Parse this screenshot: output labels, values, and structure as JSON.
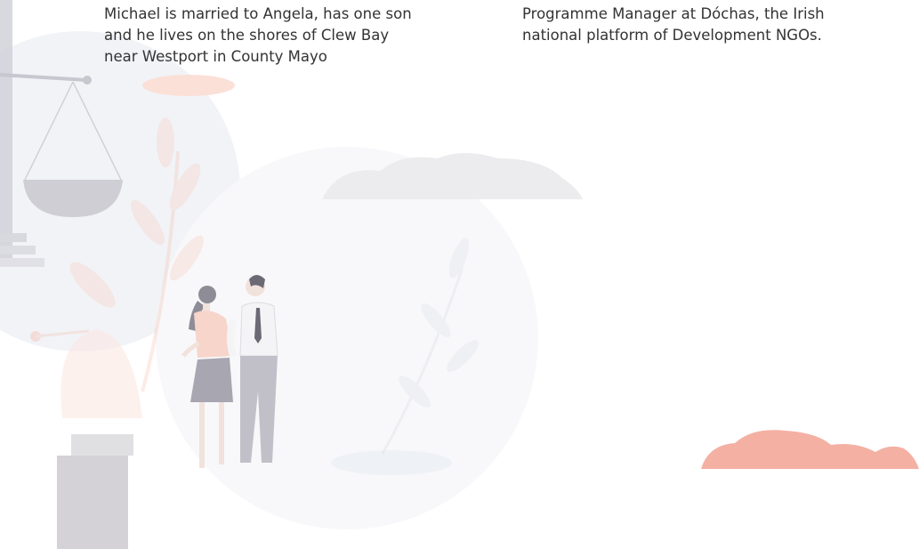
{
  "left_column": {
    "lines": [
      "Michael is married to Angela, has one son",
      "and he lives on the shores of Clew Bay",
      "near Westport in County Mayo"
    ]
  },
  "right_column": {
    "lines": [
      "Programme Manager at Dóchas, the Irish",
      "national platform of Development NGOs."
    ]
  },
  "colors": {
    "text": "#333333",
    "accent_salmon": "#f4b1a3",
    "cloud_grey": "#ececee",
    "figure_grey": "#c8c6cc"
  }
}
